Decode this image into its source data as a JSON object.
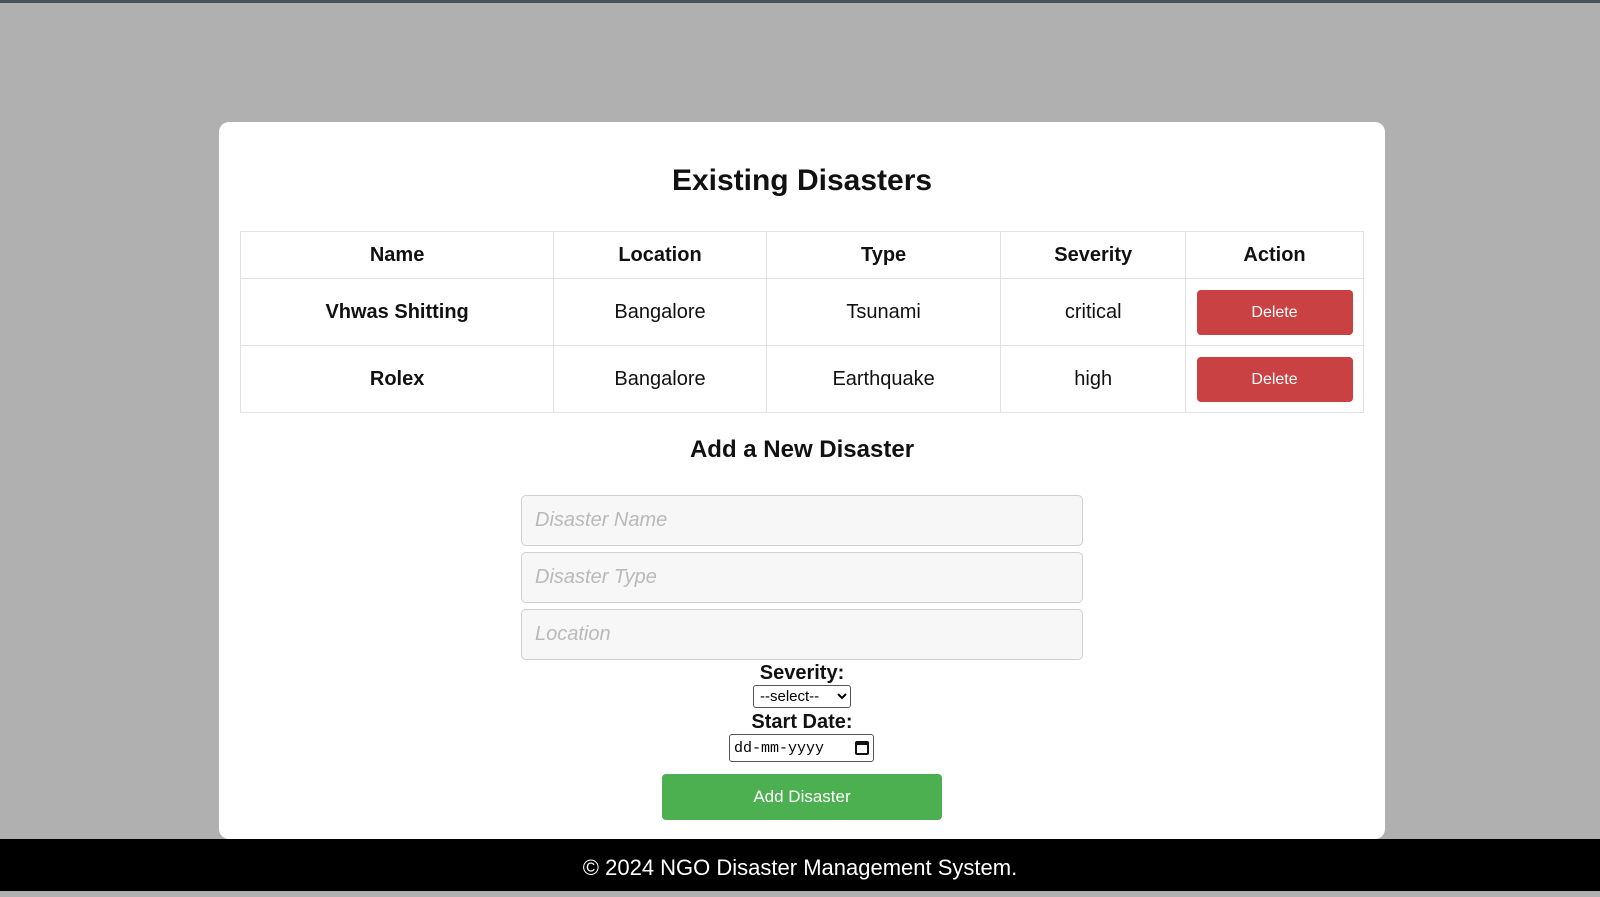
{
  "main": {
    "title": "Existing Disasters",
    "table": {
      "headers": [
        "Name",
        "Location",
        "Type",
        "Severity",
        "Action"
      ],
      "rows": [
        {
          "name": "Vhwas Shitting",
          "location": "Bangalore",
          "type": "Tsunami",
          "severity": "critical",
          "action": "Delete"
        },
        {
          "name": "Rolex",
          "location": "Bangalore",
          "type": "Earthquake",
          "severity": "high",
          "action": "Delete"
        }
      ]
    }
  },
  "form": {
    "title": "Add a New Disaster",
    "name_placeholder": "Disaster Name",
    "type_placeholder": "Disaster Type",
    "location_placeholder": "Location",
    "severity_label": "Severity:",
    "severity_selected": "--select--",
    "start_date_label": "Start Date:",
    "start_date_placeholder": "dd-mm-yyyy",
    "submit_label": "Add Disaster"
  },
  "footer": {
    "text": "© 2024 NGO Disaster Management System."
  },
  "colors": {
    "background": "#b0b0b0",
    "delete_button": "#c94142",
    "add_button": "#4caf50",
    "footer": "#000000"
  },
  "icons": {
    "date_picker": "calendar-icon",
    "select": "chevron-down-icon"
  }
}
